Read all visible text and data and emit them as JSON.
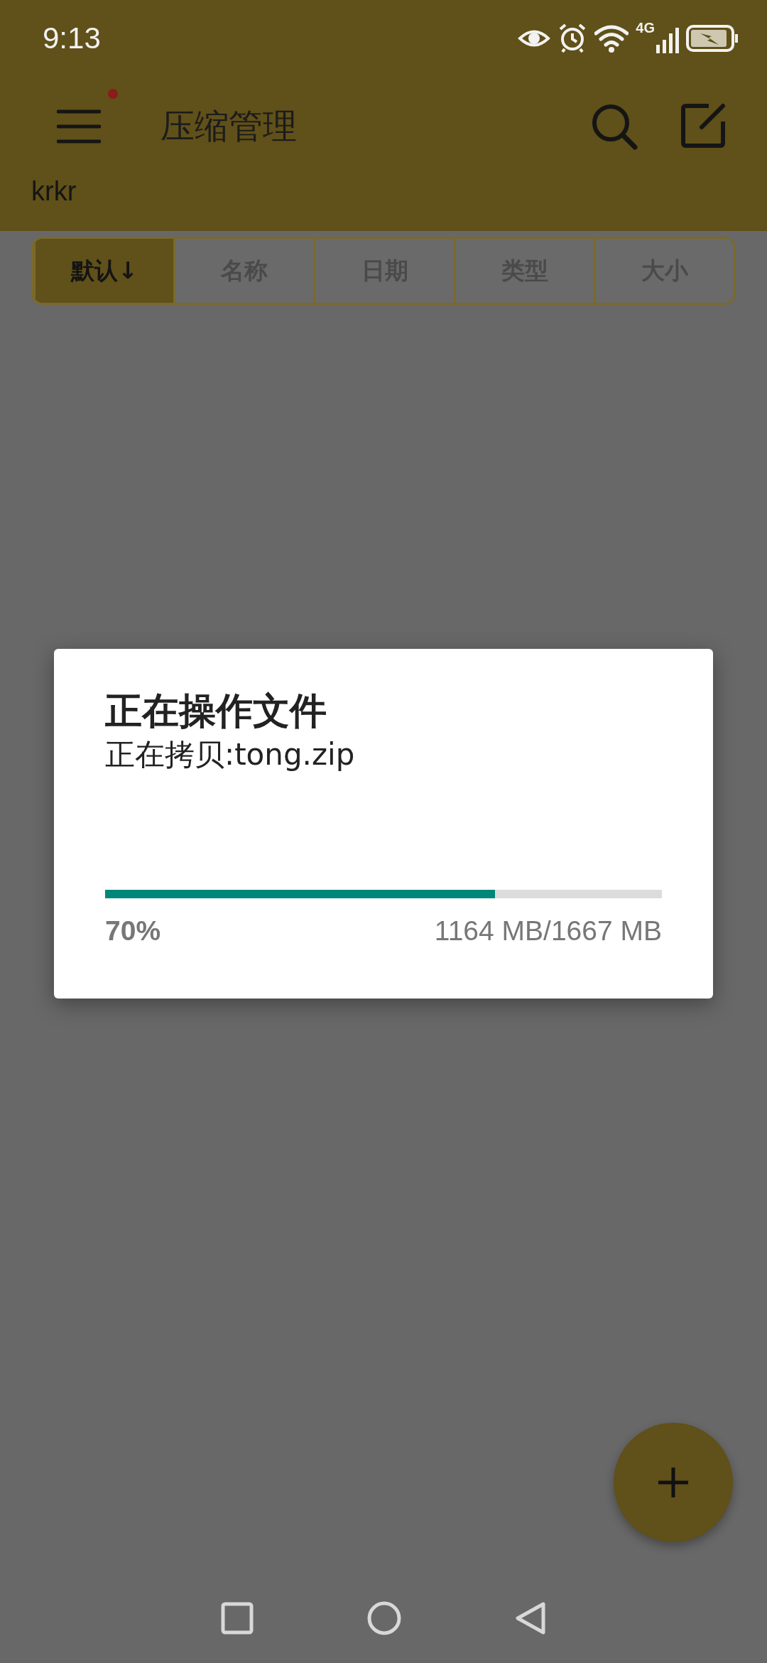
{
  "status_bar": {
    "time": "9:13",
    "network": "4G"
  },
  "app_bar": {
    "title": "压缩管理",
    "path": "krkr",
    "menu_badge": true
  },
  "sort_tabs": [
    {
      "label": "默认↓",
      "selected": true
    },
    {
      "label": "名称",
      "selected": false
    },
    {
      "label": "日期",
      "selected": false
    },
    {
      "label": "类型",
      "selected": false
    },
    {
      "label": "大小",
      "selected": false
    }
  ],
  "dialog": {
    "title": "正在操作文件",
    "message": "正在拷贝:tong.zip",
    "level": 0.7,
    "percent": "70%",
    "size": "1164 MB/1667 MB"
  }
}
